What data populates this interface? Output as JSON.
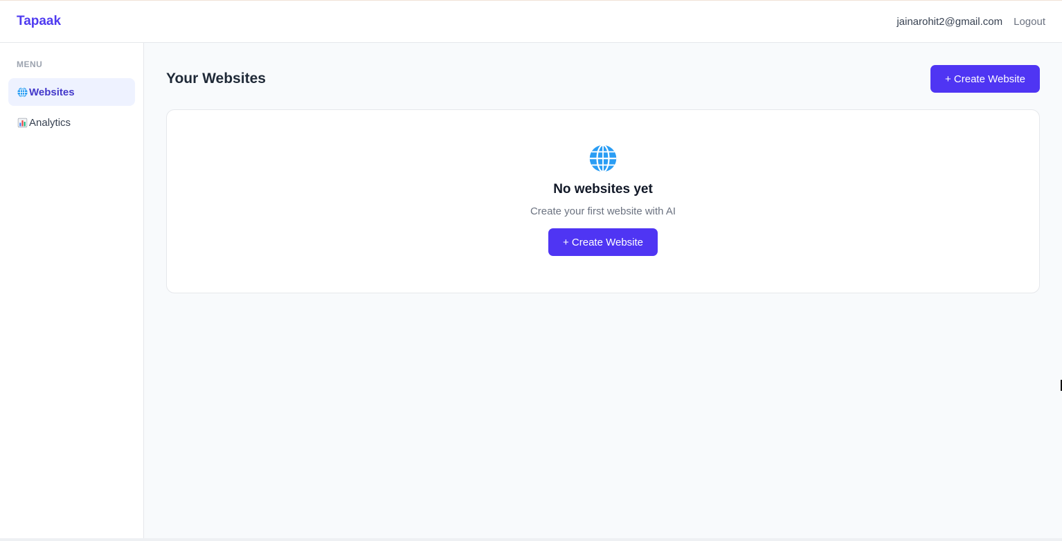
{
  "header": {
    "brand": "Tapaak",
    "user_email": "jainarohit2@gmail.com",
    "logout_label": "Logout"
  },
  "sidebar": {
    "heading": "MENU",
    "items": [
      {
        "label": "Websites",
        "icon": "globe-icon",
        "active": true
      },
      {
        "label": "Analytics",
        "icon": "bar-chart-icon",
        "active": false
      }
    ]
  },
  "main": {
    "title": "Your Websites",
    "create_button_label": "+ Create Website",
    "empty_state": {
      "icon": "globe-icon",
      "title": "No websites yet",
      "subtitle": "Create your first website with AI",
      "button_label": "+ Create Website"
    }
  },
  "colors": {
    "accent": "#4f35f3",
    "brand": "#4f3bf0",
    "active_nav_bg": "#eef2ff"
  }
}
